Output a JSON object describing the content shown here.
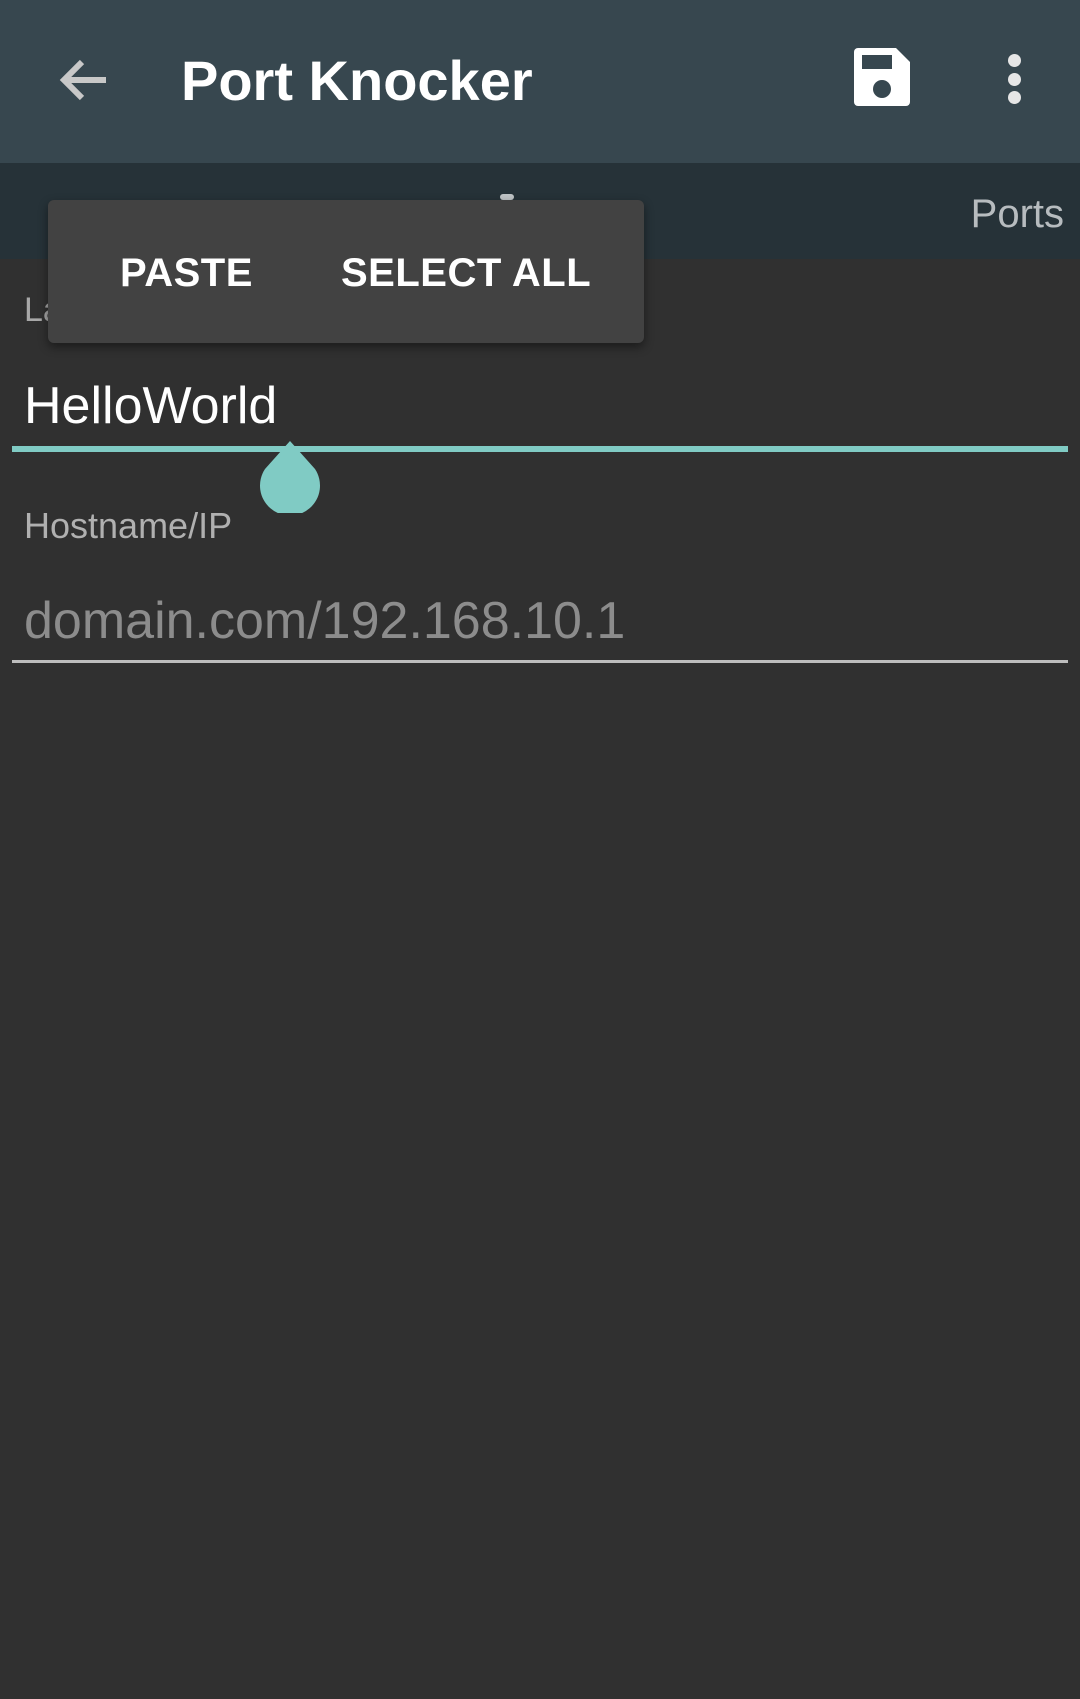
{
  "appbar": {
    "title": "Port Knocker",
    "back_icon": "arrow-left-icon",
    "save_icon": "floppy-disk-icon",
    "more_icon": "more-vertical-icon"
  },
  "tabs": {
    "ports_label": "Ports"
  },
  "context_menu": {
    "paste_label": "PASTE",
    "select_all_label": "SELECT ALL"
  },
  "form": {
    "label_field": {
      "label_visible": "La",
      "value": "HelloWorld"
    },
    "hostname_field": {
      "label": "Hostname/IP",
      "value": "",
      "placeholder": "domain.com/192.168.10.1"
    }
  },
  "colors": {
    "appbar": "#37474f",
    "tabbar": "#263238",
    "background": "#303030",
    "accent": "#80cbc4",
    "popup": "#424242"
  }
}
